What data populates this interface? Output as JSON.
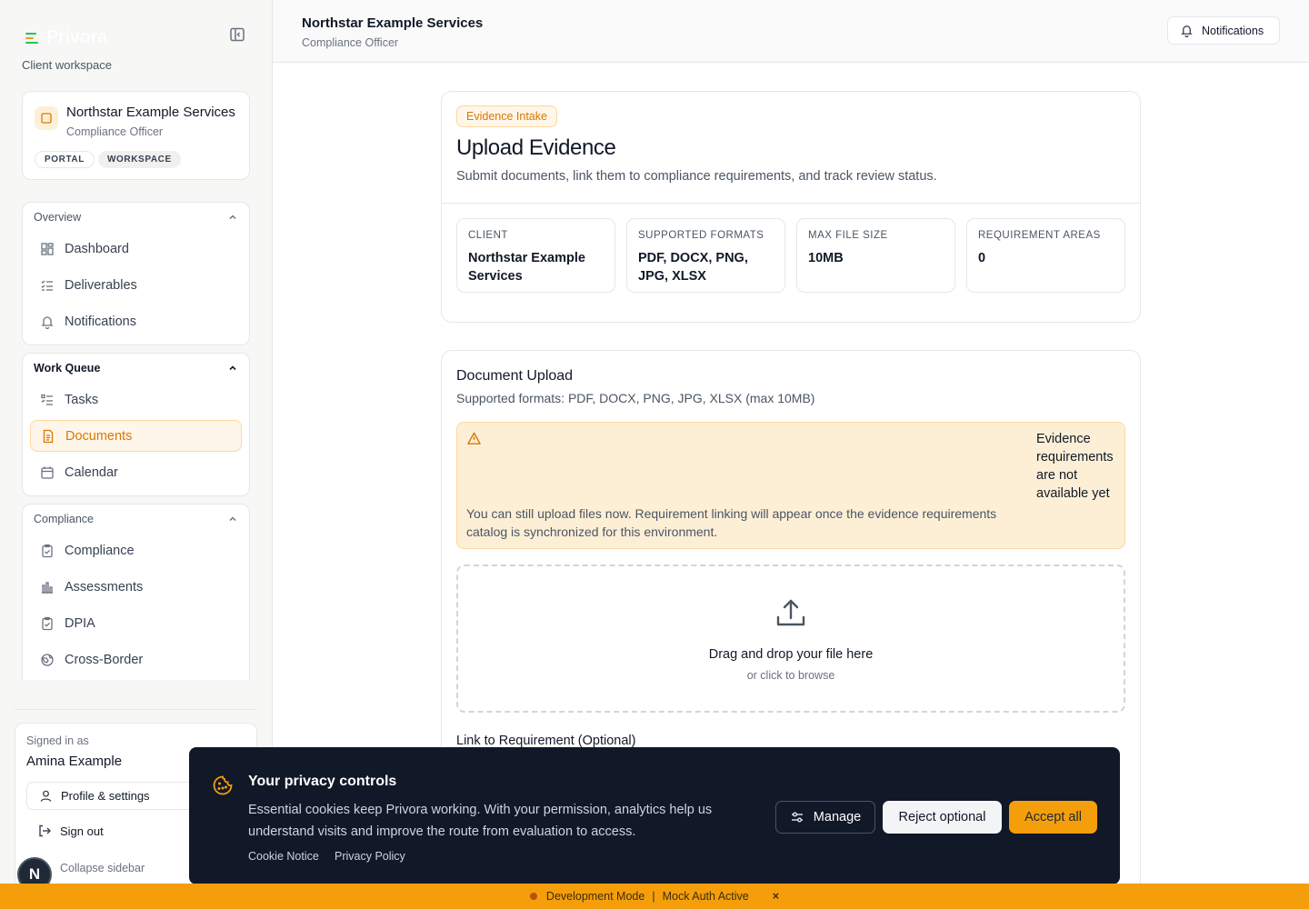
{
  "brand": {
    "name": "Privora",
    "workspace_label": "Client workspace"
  },
  "client": {
    "name": "Northstar Example Services",
    "role": "Compliance Officer",
    "tags": [
      "PORTAL",
      "WORKSPACE"
    ]
  },
  "nav": {
    "overview": {
      "title": "Overview",
      "items": [
        "Dashboard",
        "Deliverables",
        "Notifications"
      ]
    },
    "work_queue": {
      "title": "Work Queue",
      "items": [
        "Tasks",
        "Documents",
        "Calendar"
      ],
      "active": "Documents"
    },
    "compliance": {
      "title": "Compliance",
      "items": [
        "Compliance",
        "Assessments",
        "DPIA",
        "Cross-Border"
      ]
    }
  },
  "user": {
    "signed_in_label": "Signed in as",
    "name": "Amina Example",
    "profile_label": "Profile & settings",
    "signout_label": "Sign out",
    "collapse_label": "Collapse sidebar",
    "avatar_initial": "N"
  },
  "header": {
    "title": "Northstar Example Services",
    "subtitle": "Compliance Officer",
    "notifications_label": "Notifications"
  },
  "intake": {
    "badge": "Evidence Intake",
    "title": "Upload Evidence",
    "description": "Submit documents, link them to compliance requirements, and track review status.",
    "stats": [
      {
        "label": "CLIENT",
        "value": "Northstar Example Services"
      },
      {
        "label": "SUPPORTED FORMATS",
        "value": "PDF, DOCX, PNG, JPG, XLSX"
      },
      {
        "label": "MAX FILE SIZE",
        "value": "10MB"
      },
      {
        "label": "REQUIREMENT AREAS",
        "value": "0"
      }
    ]
  },
  "upload": {
    "title": "Document Upload",
    "subtitle": "Supported formats: PDF, DOCX, PNG, JPG, XLSX (max 10MB)",
    "warning_title": "Evidence requirements are not available yet",
    "warning_body": "You can still upload files now. Requirement linking will appear once the evidence requirements catalog is synchronized for this environment.",
    "dropzone_title": "Drag and drop your file here",
    "dropzone_sub": "or click to browse",
    "link_label": "Link to Requirement (Optional)"
  },
  "cookie": {
    "title": "Your privacy controls",
    "body": "Essential cookies keep Privora working. With your permission, analytics help us understand visits and improve the route from evaluation to access.",
    "links": [
      "Cookie Notice",
      "Privacy Policy"
    ],
    "manage_label": "Manage",
    "reject_label": "Reject optional",
    "accept_label": "Accept all"
  },
  "devbar": {
    "mode": "Development Mode",
    "separator": "|",
    "auth": "Mock Auth Active",
    "close": "×"
  },
  "colors": {
    "accent": "#f59e0b",
    "accent_text": "#d97706",
    "banner_bg": "#111827"
  }
}
